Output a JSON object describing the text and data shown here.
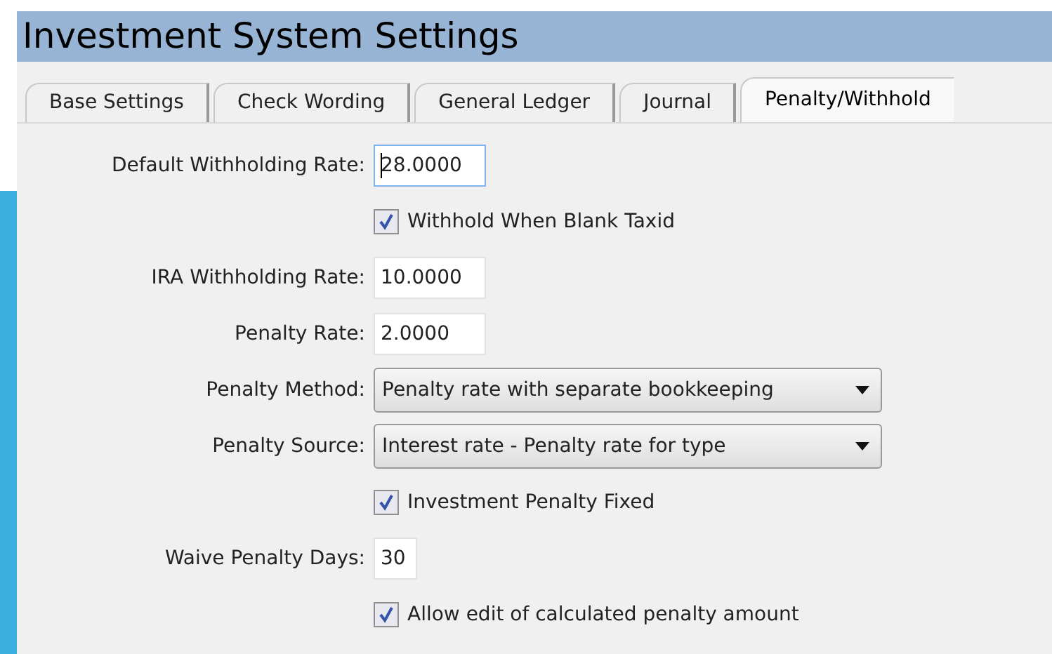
{
  "window": {
    "title": "Investment System Settings"
  },
  "tabs": [
    {
      "label": "Base Settings",
      "selected": false
    },
    {
      "label": "Check Wording",
      "selected": false
    },
    {
      "label": "General Ledger",
      "selected": false
    },
    {
      "label": "Journal",
      "selected": false
    },
    {
      "label": "Penalty/Withhold",
      "selected": true
    }
  ],
  "fields": [
    {
      "kind": "text",
      "label": "Default Withholding Rate:",
      "value": "28.0000",
      "focused": true
    },
    {
      "kind": "checkbox",
      "label": "Withhold When Blank Taxid",
      "checked": true
    },
    {
      "kind": "text",
      "label": "IRA Withholding Rate:",
      "value": "10.0000",
      "focused": false
    },
    {
      "kind": "text",
      "label": "Penalty Rate:",
      "value": "2.0000",
      "focused": false
    },
    {
      "kind": "select",
      "label": "Penalty Method:",
      "value": "Penalty rate with separate bookkeeping"
    },
    {
      "kind": "select",
      "label": "Penalty Source:",
      "value": "Interest rate - Penalty rate for type"
    },
    {
      "kind": "checkbox",
      "label": "Investment Penalty Fixed",
      "checked": true
    },
    {
      "kind": "short-text",
      "label": "Waive Penalty Days:",
      "value": "30",
      "focused": false
    },
    {
      "kind": "checkbox",
      "label": "Allow edit of calculated penalty amount",
      "checked": true
    }
  ]
}
